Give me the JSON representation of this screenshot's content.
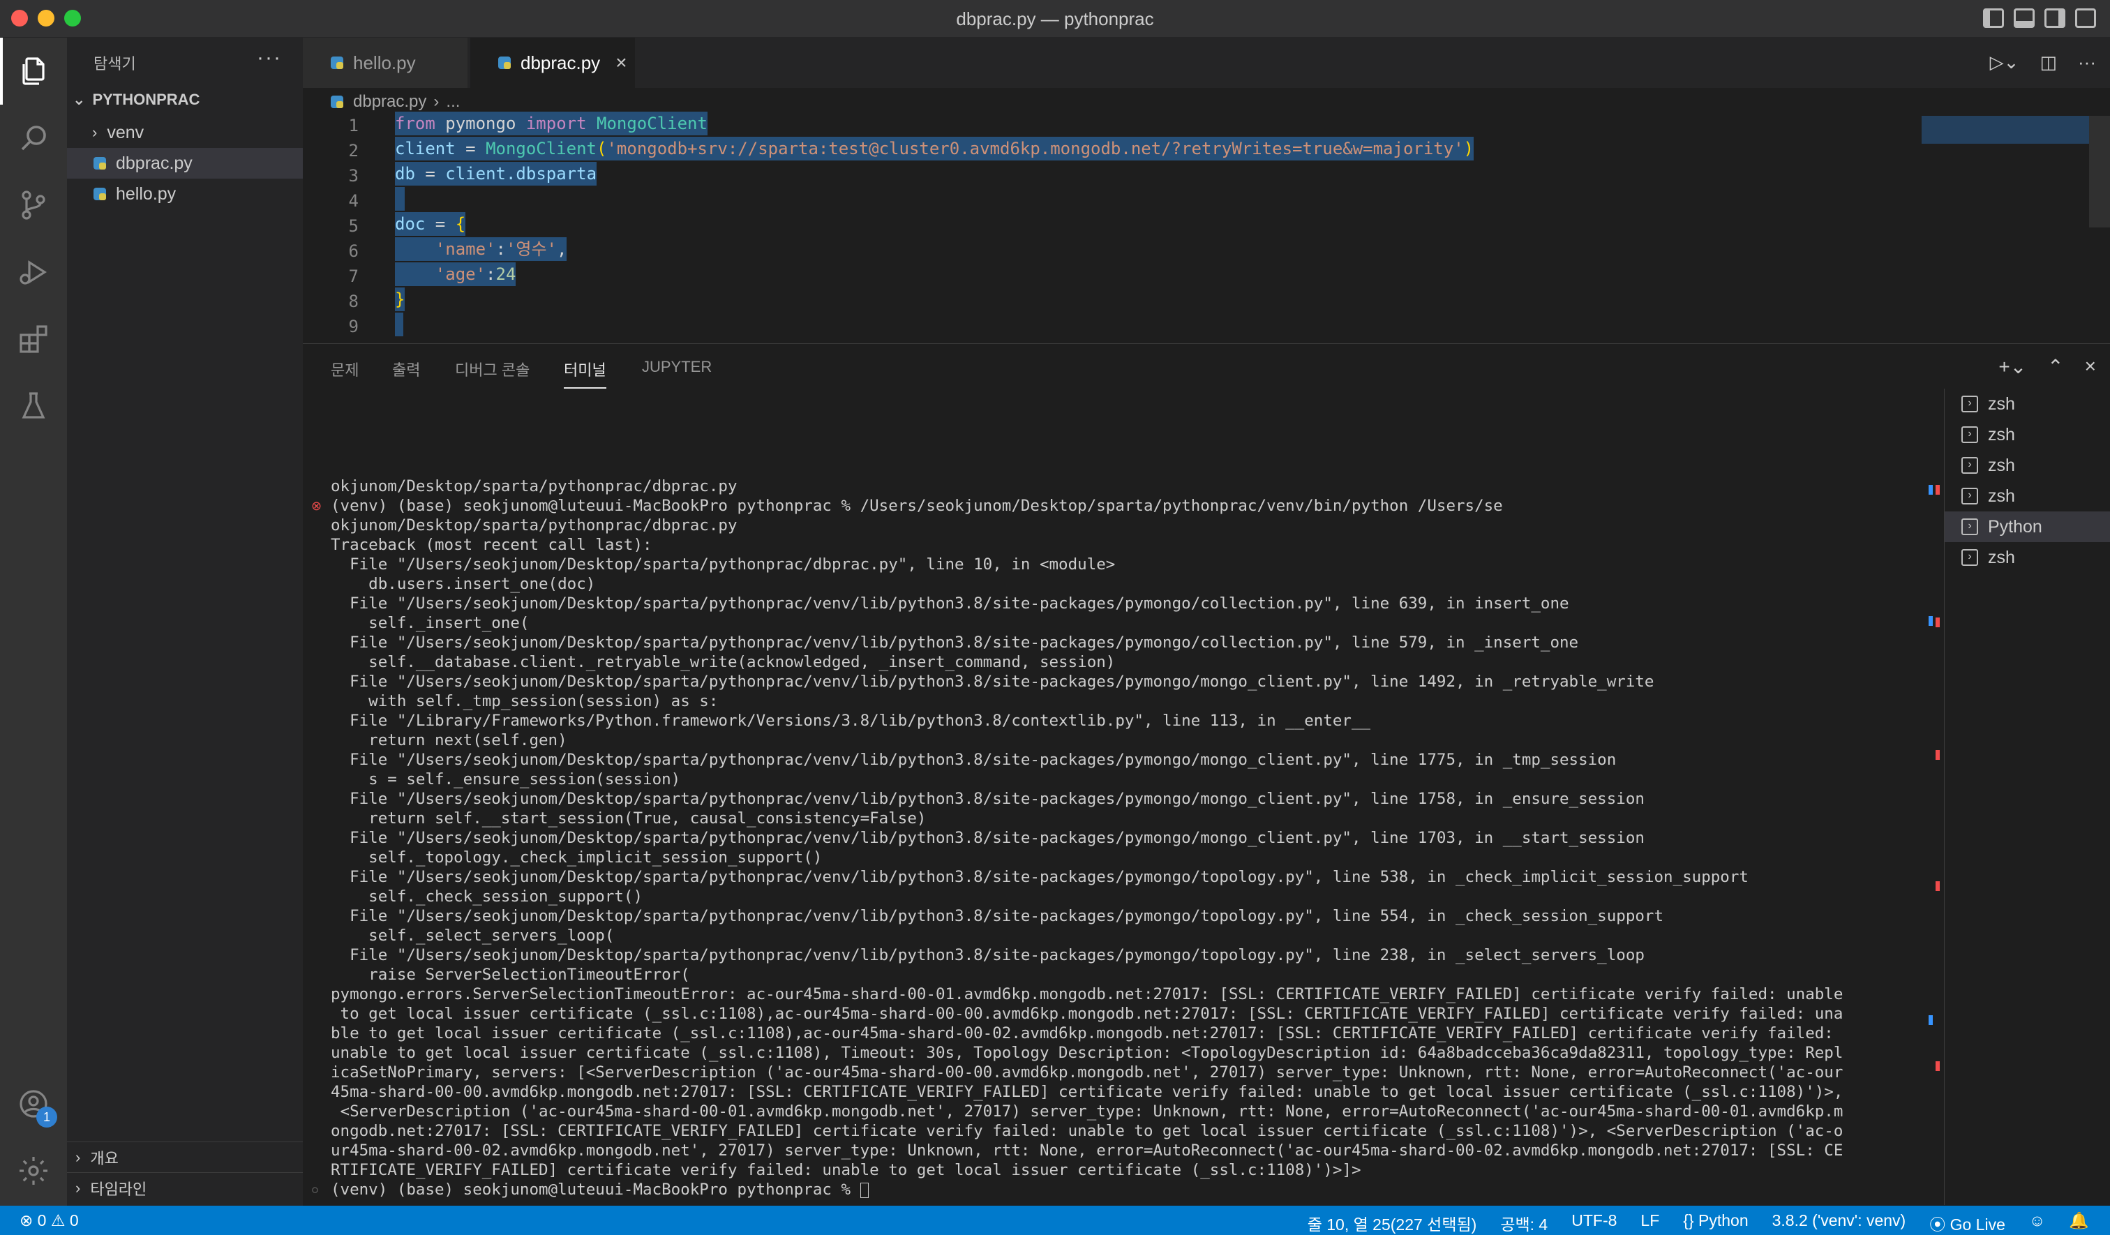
{
  "window": {
    "title": "dbprac.py — pythonprac"
  },
  "sidebar": {
    "header": "탐색기",
    "more": "···",
    "root": "PYTHONPRAC",
    "items": [
      {
        "label": "venv",
        "type": "folder"
      },
      {
        "label": "dbprac.py",
        "type": "python",
        "selected": true
      },
      {
        "label": "hello.py",
        "type": "python"
      }
    ],
    "sections": [
      "개요",
      "타임라인"
    ]
  },
  "activity": {
    "badge": "1"
  },
  "tabs": [
    {
      "label": "hello.py",
      "active": false
    },
    {
      "label": "dbprac.py",
      "active": true
    }
  ],
  "breadcrumb": {
    "file": "dbprac.py",
    "rest": "..."
  },
  "editor": {
    "lines": [
      {
        "n": "1"
      },
      {
        "n": "2"
      },
      {
        "n": "3"
      },
      {
        "n": "4"
      },
      {
        "n": "5"
      },
      {
        "n": "6"
      },
      {
        "n": "7"
      },
      {
        "n": "8"
      },
      {
        "n": "9"
      }
    ],
    "code": {
      "l1a": "from",
      "l1b": " pymongo ",
      "l1c": "import",
      "l1d": " MongoClient",
      "l2a": "client",
      "l2b": " = ",
      "l2c": "MongoClient",
      "l2d": "(",
      "l2e": "'mongodb+srv://sparta:test@cluster0.avmd6kp.mongodb.net/?retryWrites=true&w=majority'",
      "l2f": ")",
      "l3a": "db",
      "l3b": " = ",
      "l3c": "client",
      "l3d": ".dbsparta",
      "l5a": "doc",
      "l5b": " = ",
      "l5c": "{",
      "l6a": "    ",
      "l6b": "'name'",
      "l6c": ":",
      "l6d": "'영수'",
      "l6e": ",",
      "l7a": "    ",
      "l7b": "'age'",
      "l7c": ":",
      "l7d": "24",
      "l8a": "}"
    }
  },
  "panel": {
    "tabs": [
      "문제",
      "출력",
      "디버그 콘솔",
      "터미널",
      "JUPYTER"
    ],
    "active_tab": "터미널",
    "terminal_lines": [
      "okjunom/Desktop/sparta/pythonprac/dbprac.py",
      "(venv) (base) seokjunom@luteuui-MacBookPro pythonprac % /Users/seokjunom/Desktop/sparta/pythonprac/venv/bin/python /Users/se",
      "okjunom/Desktop/sparta/pythonprac/dbprac.py",
      "Traceback (most recent call last):",
      "  File \"/Users/seokjunom/Desktop/sparta/pythonprac/dbprac.py\", line 10, in <module>",
      "    db.users.insert_one(doc)",
      "  File \"/Users/seokjunom/Desktop/sparta/pythonprac/venv/lib/python3.8/site-packages/pymongo/collection.py\", line 639, in insert_one",
      "    self._insert_one(",
      "  File \"/Users/seokjunom/Desktop/sparta/pythonprac/venv/lib/python3.8/site-packages/pymongo/collection.py\", line 579, in _insert_one",
      "    self.__database.client._retryable_write(acknowledged, _insert_command, session)",
      "  File \"/Users/seokjunom/Desktop/sparta/pythonprac/venv/lib/python3.8/site-packages/pymongo/mongo_client.py\", line 1492, in _retryable_write",
      "    with self._tmp_session(session) as s:",
      "  File \"/Library/Frameworks/Python.framework/Versions/3.8/lib/python3.8/contextlib.py\", line 113, in __enter__",
      "    return next(self.gen)",
      "  File \"/Users/seokjunom/Desktop/sparta/pythonprac/venv/lib/python3.8/site-packages/pymongo/mongo_client.py\", line 1775, in _tmp_session",
      "    s = self._ensure_session(session)",
      "  File \"/Users/seokjunom/Desktop/sparta/pythonprac/venv/lib/python3.8/site-packages/pymongo/mongo_client.py\", line 1758, in _ensure_session",
      "    return self.__start_session(True, causal_consistency=False)",
      "  File \"/Users/seokjunom/Desktop/sparta/pythonprac/venv/lib/python3.8/site-packages/pymongo/mongo_client.py\", line 1703, in __start_session",
      "    self._topology._check_implicit_session_support()",
      "  File \"/Users/seokjunom/Desktop/sparta/pythonprac/venv/lib/python3.8/site-packages/pymongo/topology.py\", line 538, in _check_implicit_session_support",
      "    self._check_session_support()",
      "  File \"/Users/seokjunom/Desktop/sparta/pythonprac/venv/lib/python3.8/site-packages/pymongo/topology.py\", line 554, in _check_session_support",
      "    self._select_servers_loop(",
      "  File \"/Users/seokjunom/Desktop/sparta/pythonprac/venv/lib/python3.8/site-packages/pymongo/topology.py\", line 238, in _select_servers_loop",
      "    raise ServerSelectionTimeoutError(",
      "pymongo.errors.ServerSelectionTimeoutError: ac-our45ma-shard-00-01.avmd6kp.mongodb.net:27017: [SSL: CERTIFICATE_VERIFY_FAILED] certificate verify failed: unable",
      " to get local issuer certificate (_ssl.c:1108),ac-our45ma-shard-00-00.avmd6kp.mongodb.net:27017: [SSL: CERTIFICATE_VERIFY_FAILED] certificate verify failed: una",
      "ble to get local issuer certificate (_ssl.c:1108),ac-our45ma-shard-00-02.avmd6kp.mongodb.net:27017: [SSL: CERTIFICATE_VERIFY_FAILED] certificate verify failed:",
      "unable to get local issuer certificate (_ssl.c:1108), Timeout: 30s, Topology Description: <TopologyDescription id: 64a8badcceba36ca9da82311, topology_type: Repl",
      "icaSetNoPrimary, servers: [<ServerDescription ('ac-our45ma-shard-00-00.avmd6kp.mongodb.net', 27017) server_type: Unknown, rtt: None, error=AutoReconnect('ac-our",
      "45ma-shard-00-00.avmd6kp.mongodb.net:27017: [SSL: CERTIFICATE_VERIFY_FAILED] certificate verify failed: unable to get local issuer certificate (_ssl.c:1108)')>,",
      " <ServerDescription ('ac-our45ma-shard-00-01.avmd6kp.mongodb.net', 27017) server_type: Unknown, rtt: None, error=AutoReconnect('ac-our45ma-shard-00-01.avmd6kp.m",
      "ongodb.net:27017: [SSL: CERTIFICATE_VERIFY_FAILED] certificate verify failed: unable to get local issuer certificate (_ssl.c:1108)')>, <ServerDescription ('ac-o",
      "ur45ma-shard-00-02.avmd6kp.mongodb.net', 27017) server_type: Unknown, rtt: None, error=AutoReconnect('ac-our45ma-shard-00-02.avmd6kp.mongodb.net:27017: [SSL: CE",
      "RTIFICATE_VERIFY_FAILED] certificate verify failed: unable to get local issuer certificate (_ssl.c:1108)')>]>",
      "(venv) (base) seokjunom@luteuui-MacBookPro pythonprac % "
    ],
    "terminals": [
      {
        "label": "zsh",
        "selected": false
      },
      {
        "label": "zsh",
        "selected": false
      },
      {
        "label": "zsh",
        "selected": false
      },
      {
        "label": "zsh",
        "selected": false
      },
      {
        "label": "Python",
        "selected": true
      },
      {
        "label": "zsh",
        "selected": false
      }
    ]
  },
  "statusbar": {
    "errors": "0",
    "warnings": "0",
    "position": "줄 10, 열 25(227 선택됨)",
    "indent": "공백: 4",
    "encoding": "UTF-8",
    "eol": "LF",
    "language": "Python",
    "interpreter": "3.8.2 ('venv': venv)",
    "golive": "Go Live"
  },
  "colors": {
    "accent": "#007acc",
    "error": "#f14c4c",
    "selection": "#264f78"
  }
}
